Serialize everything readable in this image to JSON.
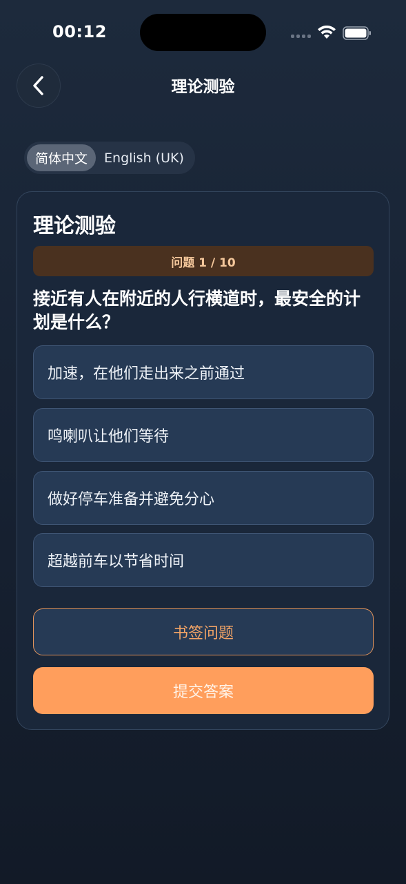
{
  "status_bar": {
    "time": "00:12"
  },
  "nav": {
    "title": "理论测验"
  },
  "language": {
    "options": [
      "简体中文",
      "English (UK)"
    ],
    "selected": "简体中文"
  },
  "quiz": {
    "title": "理论测验",
    "progress": "问题 1 / 10",
    "question": "接近有人在附近的人行横道时，最安全的计划是什么？",
    "options": [
      "加速，在他们走出来之前通过",
      "鸣喇叭让他们等待",
      "做好停车准备并避免分心",
      "超越前车以节省时间"
    ],
    "bookmark_label": "书签问题",
    "submit_label": "提交答案"
  },
  "colors": {
    "accent": "#ff9e5c",
    "card_bg": "#1a273a",
    "option_bg": "#263a55",
    "progress_bg": "#4a311f"
  }
}
